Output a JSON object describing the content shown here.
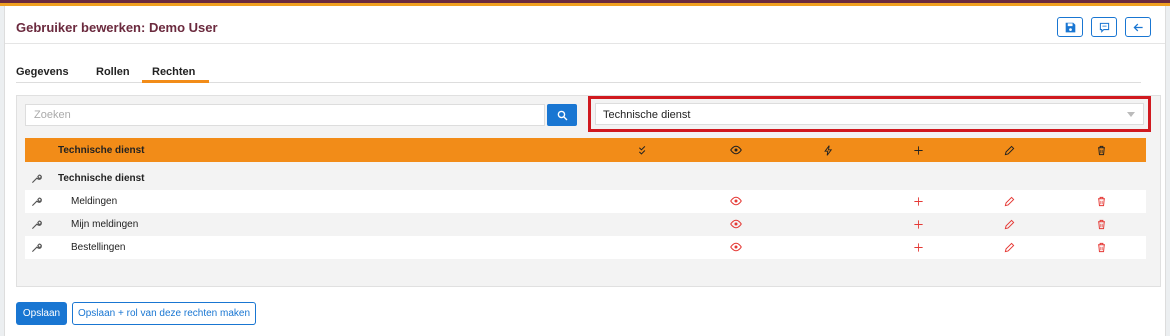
{
  "page": {
    "title": "Gebruiker bewerken: Demo User"
  },
  "header_buttons": [
    {
      "name": "save-icon"
    },
    {
      "name": "comment-icon"
    },
    {
      "name": "back-arrow-icon"
    }
  ],
  "tabs": [
    {
      "label": "Gegevens",
      "active": false
    },
    {
      "label": "Rollen",
      "active": false
    },
    {
      "label": "Rechten",
      "active": true
    }
  ],
  "search": {
    "placeholder": "Zoeken"
  },
  "module_select": {
    "selected": "Technische dienst"
  },
  "table": {
    "header_label": "Technische dienst",
    "column_icons": [
      "double-check-icon",
      "eye-icon",
      "bolt-icon",
      "plus-icon",
      "pencil-icon",
      "trash-icon"
    ],
    "group": {
      "label": "Technische dienst"
    },
    "rows": [
      {
        "label": "Meldingen",
        "view": true,
        "add": true,
        "edit": true,
        "delete": true
      },
      {
        "label": "Mijn meldingen",
        "view": true,
        "add": true,
        "edit": true,
        "delete": true
      },
      {
        "label": "Bestellingen",
        "view": true,
        "add": true,
        "edit": true,
        "delete": true
      }
    ]
  },
  "colors": {
    "accent": "#f28c18",
    "primary": "#1976d2",
    "title": "#6b2a3e",
    "perm_red": "#e53935"
  },
  "footer": {
    "save_label": "Opslaan",
    "save_role_label": "Opslaan + rol van deze rechten maken"
  }
}
